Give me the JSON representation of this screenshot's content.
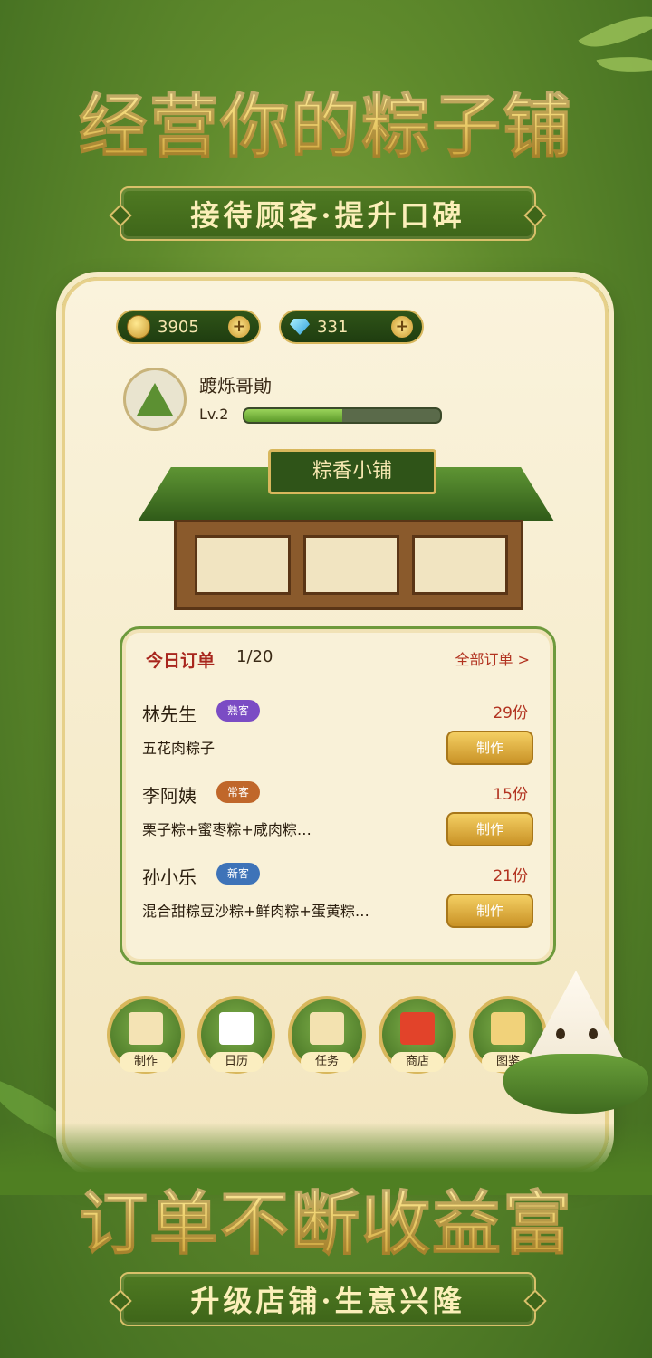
{
  "hero": {
    "title": "经营你的粽子铺",
    "subtitle": "接待顾客·提升口碑"
  },
  "footer": {
    "title": "订单不断收益富",
    "subtitle": "升级店铺·生意兴隆"
  },
  "currency": {
    "coins": "3905",
    "gems": "331",
    "plus_glyph": "+"
  },
  "player": {
    "name": "踱烁哥勛",
    "level_label": "Lv.2",
    "level_progress": 0.5
  },
  "shop": {
    "sign": "粽香小铺"
  },
  "orders": {
    "title": "今日订单",
    "count": "1/20",
    "link": "全部订单 >",
    "rows": [
      {
        "customer": "林先生",
        "tag": "熟客",
        "tag_color": "#7b4cc4",
        "price": "29份",
        "items": "五花肉粽子",
        "button": "制作"
      },
      {
        "customer": "李阿姨",
        "tag": "常客",
        "tag_color": "#c0672a",
        "price": "15份",
        "items": "栗子粽+蜜枣粽+咸肉粽…",
        "button": "制作"
      },
      {
        "customer": "孙小乐",
        "tag": "新客",
        "tag_color": "#3e73b8",
        "price": "21份",
        "items": "混合甜粽豆沙粽+鲜肉粽+蛋黄粽…",
        "button": "制作"
      }
    ]
  },
  "menu": [
    {
      "label": "制作",
      "icon": "envelope-icon",
      "color": "#f4e3b4"
    },
    {
      "label": "日历",
      "icon": "calendar-icon",
      "color": "#ffffff"
    },
    {
      "label": "任务",
      "icon": "scroll-icon",
      "color": "#f3e2b0"
    },
    {
      "label": "商店",
      "icon": "shopping-bag-icon",
      "color": "#e2432a"
    },
    {
      "label": "图鉴",
      "icon": "book-icon",
      "color": "#f1d27a"
    }
  ],
  "colors": {
    "background": "#5f8a2c",
    "gold": "#d8b75c",
    "accent_red": "#b23320"
  }
}
